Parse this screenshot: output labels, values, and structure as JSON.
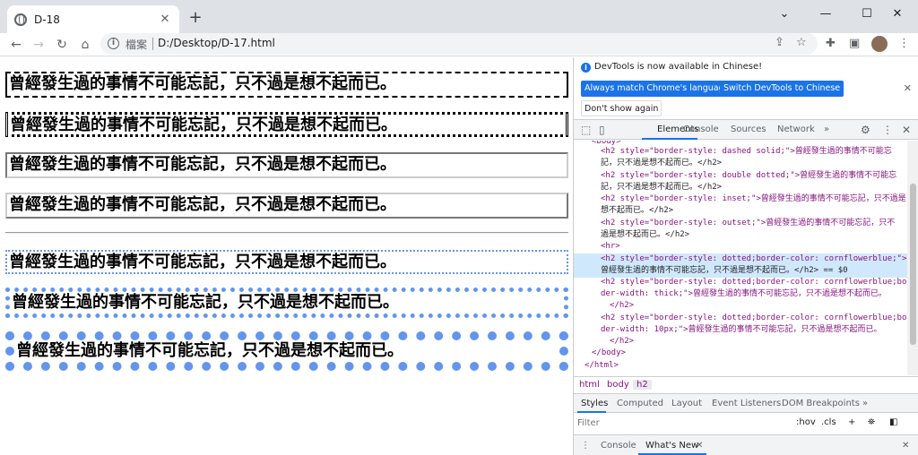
{
  "browser": {
    "tab_title": "D-18",
    "tab_close": "✕",
    "new_tab": "+",
    "omnibox_label": "檔案",
    "url": "D:/Desktop/D-17.html"
  },
  "page": {
    "headings": [
      "曾經發生過的事情不可能忘記，只不過是想不起而已。",
      "曾經發生過的事情不可能忘記，只不過是想不起而已。",
      "曾經發生過的事情不可能忘記，只不過是想不起而已。",
      "曾經發生過的事情不可能忘記，只不過是想不起而已。",
      "曾經發生過的事情不可能忘記，只不過是想不起而已。",
      "曾經發生過的事情不可能忘記，只不過是想不起而已。",
      "曾經發生過的事情不可能忘記，只不過是想不起而已。"
    ]
  },
  "devtools": {
    "notice": "DevTools is now available in Chinese!",
    "btn_match": "Always match Chrome's language",
    "btn_switch": "Switch DevTools to Chinese",
    "btn_dont_show": "Don't show again",
    "tabs": [
      "Elements",
      "Console",
      "Sources",
      "Network"
    ],
    "more": "»",
    "code_lines": [
      "<body>",
      "<h2 style=\"border-style: dashed solid;\">曾經發生過的事情不可能忘",
      "記，只不過是想不起而已。</h2>",
      "<h2 style=\"border-style: double dotted;\">曾經發生過的事情不可能忘",
      "記，只不過是想不起而已。</h2>",
      "<h2 style=\"border-style: inset;\">曾經發生過的事情不可能忘記，只不過是",
      "想不起而已。</h2>",
      "<h2 style=\"border-style: outset;\">曾經發生過的事情不可能忘記，只不",
      "過是想不起而已。</h2>",
      "<hr>",
      "<h2 style=\"border-style: dotted;border-color: cornflowerblue;\">",
      "曾經發生過的事情不可能忘記，只不過是想不起而已。</h2> == $0",
      "<h2 style=\"border-style: dotted;border-color: cornflowerblue;bor",
      "der-width: thick;\">曾經發生過的事情不可能忘記，只不過是想不起而已。",
      "</h2>",
      "<h2 style=\"border-style: dotted;border-color: cornflowerblue;bor",
      "der-width: 10px;\">曾經發生過的事情不可能忘記，只不過是想不起而已。",
      "</h2>",
      "</body>",
      "</html>"
    ],
    "crumbs": [
      "html",
      "body",
      "h2"
    ],
    "style_tabs": [
      "Styles",
      "Computed",
      "Layout",
      "Event Listeners",
      "DOM Breakpoints"
    ],
    "filter_placeholder": "Filter",
    "hov": ":hov",
    "cls": ".cls",
    "drawer_tabs": [
      "Console",
      "What's New"
    ],
    "drawer_close": "✕"
  }
}
